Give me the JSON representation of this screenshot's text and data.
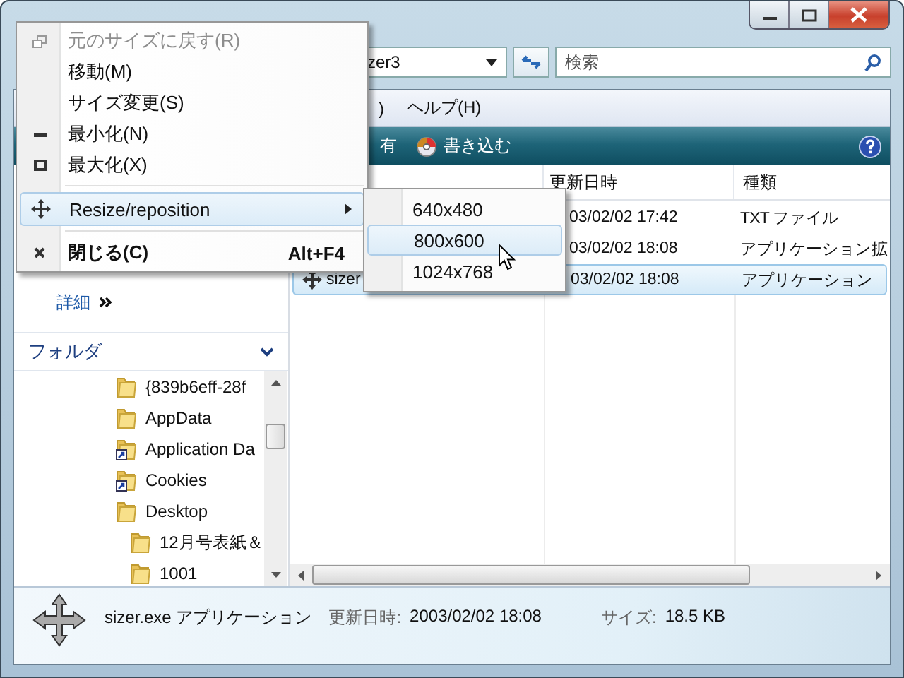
{
  "address_bar": {
    "path": "zer3"
  },
  "search": {
    "placeholder": "検索"
  },
  "menu_bar": [
    ")",
    "ヘルプ(H)"
  ],
  "toolbar": [
    {
      "label": "有",
      "kind": "plain"
    },
    {
      "label": "書き込む",
      "kind": "burn"
    }
  ],
  "left_pane": {
    "details_label": "詳細",
    "folders_title": "フォルダ",
    "tree": [
      {
        "label": "{839b6eff-28f",
        "kind": "folder"
      },
      {
        "label": "AppData",
        "kind": "folder"
      },
      {
        "label": "Application Da",
        "kind": "shortcut"
      },
      {
        "label": "Cookies",
        "kind": "shortcut"
      },
      {
        "label": "Desktop",
        "kind": "folder",
        "children": [
          {
            "label": "12月号表紙＆",
            "kind": "folder"
          },
          {
            "label": "1001",
            "kind": "folder"
          }
        ]
      }
    ]
  },
  "file_list": {
    "columns": [
      "更新日時",
      "種類"
    ],
    "rows": [
      {
        "modified": "03/02/02 17:42",
        "type": "TXT ファイル",
        "selected": false
      },
      {
        "modified": "03/02/02 18:08",
        "type": "アプリケーション拡",
        "selected": false
      },
      {
        "name": "sizer",
        "modified": "03/02/02 18:08",
        "type": "アプリケーション",
        "selected": true
      }
    ]
  },
  "details_pane": {
    "title": "sizer.exe アプリケーション",
    "fields": [
      {
        "label": "更新日時:",
        "value": "2003/02/02 18:08"
      },
      {
        "label": "サイズ:",
        "value": "18.5 KB"
      }
    ]
  },
  "system_menu": {
    "items": [
      {
        "kind": "restore",
        "label": "元のサイズに戻す(R)",
        "disabled": true,
        "selected": false
      },
      {
        "kind": "item",
        "label": "移動(M)",
        "disabled": false,
        "selected": false
      },
      {
        "kind": "item",
        "label": "サイズ変更(S)",
        "disabled": false,
        "selected": false
      },
      {
        "kind": "minimize",
        "label": "最小化(N)",
        "disabled": false,
        "selected": false
      },
      {
        "kind": "maximize",
        "label": "最大化(X)",
        "disabled": false,
        "selected": false
      },
      {
        "kind": "separator"
      },
      {
        "kind": "submenu",
        "label": "Resize/reposition",
        "disabled": false,
        "selected": true
      },
      {
        "kind": "separator"
      },
      {
        "kind": "close",
        "label": "閉じる(C)",
        "shortcut": "Alt+F4",
        "disabled": false,
        "selected": false
      }
    ]
  },
  "submenu": {
    "items": [
      {
        "label": "640x480",
        "selected": false
      },
      {
        "label": "800x600",
        "selected": true
      },
      {
        "label": "1024x768",
        "selected": false
      }
    ]
  }
}
